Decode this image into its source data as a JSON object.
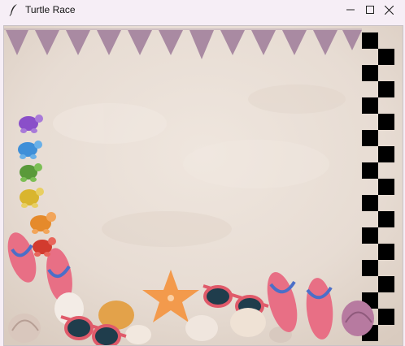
{
  "window": {
    "title": "Turtle Race",
    "controls": {
      "minimize": "minimize",
      "maximize": "maximize",
      "close": "close"
    }
  },
  "scene": {
    "background": "sand",
    "bunting_color": "#a98aa2",
    "finish_line": "checkered",
    "turtles": [
      {
        "name": "purple-turtle",
        "color": "#8a4fc9"
      },
      {
        "name": "blue-turtle",
        "color": "#3f8fd8"
      },
      {
        "name": "green-turtle",
        "color": "#5a9a3a"
      },
      {
        "name": "yellow-turtle",
        "color": "#d9b52e"
      },
      {
        "name": "orange-turtle",
        "color": "#e58a2b"
      },
      {
        "name": "red-turtle",
        "color": "#d23b2e"
      }
    ]
  }
}
